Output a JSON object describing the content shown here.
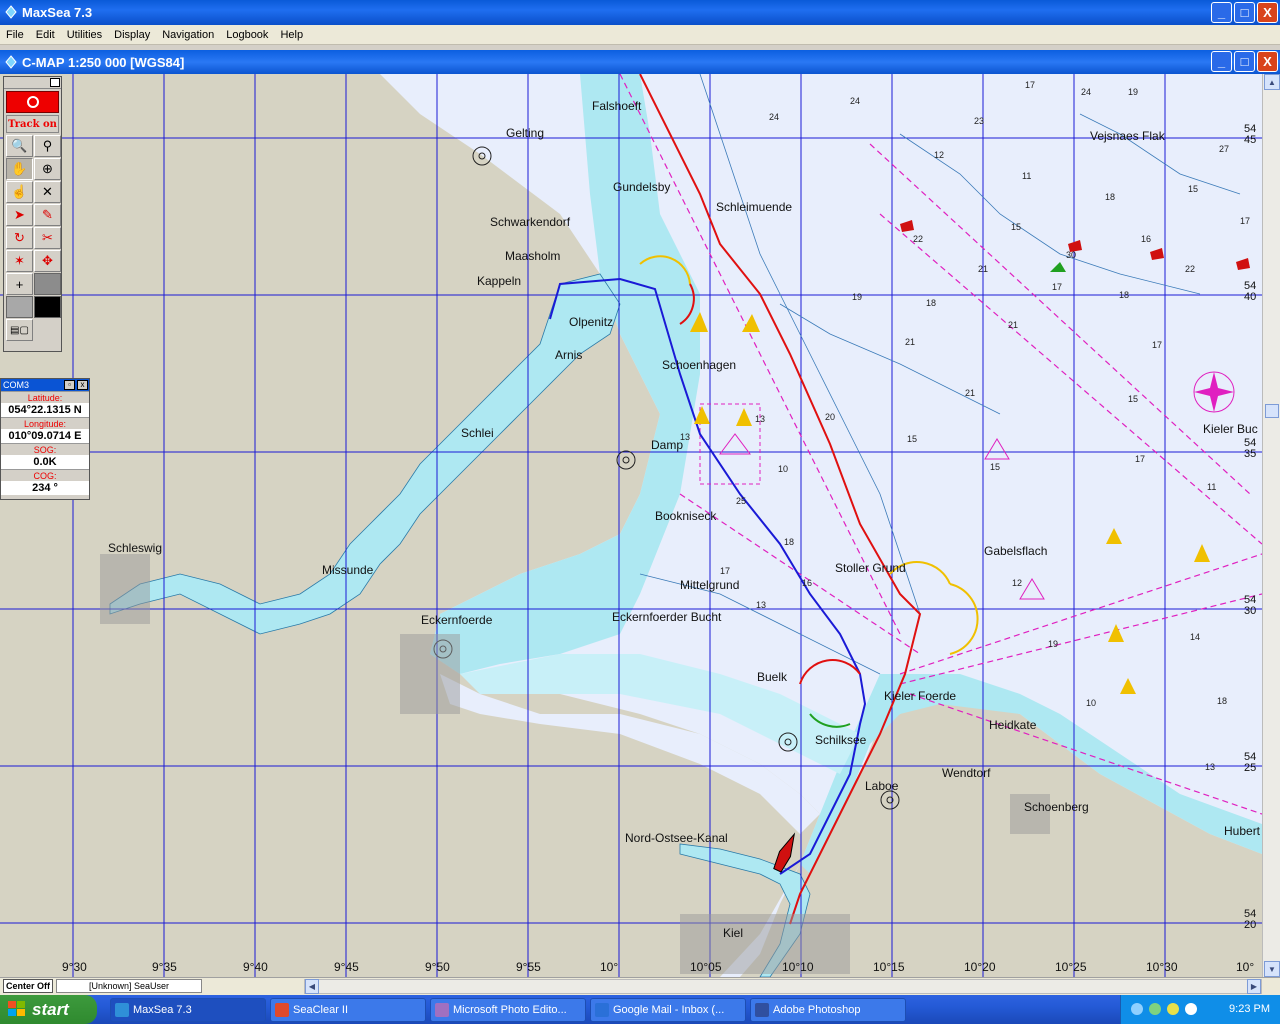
{
  "window": {
    "title": "MaxSea 7.3",
    "buttons": {
      "min": "_",
      "max": "□",
      "close": "X"
    }
  },
  "menu": [
    "File",
    "Edit",
    "Utilities",
    "Display",
    "Navigation",
    "Logbook",
    "Help"
  ],
  "chart_window": {
    "title": "C-MAP  1:250 000 [WGS84]"
  },
  "toolbox": {
    "track_label": "Track on"
  },
  "com_panel": {
    "title": "COM3",
    "latitude_label": "Latitude:",
    "latitude": "054°22.1315 N",
    "longitude_label": "Longitude:",
    "longitude": "010°09.0714 E",
    "sog_label": "SOG:",
    "sog": "0.0K",
    "cog_label": "COG:",
    "cog": "234 °"
  },
  "places": [
    {
      "name": "Falshoeft"
    },
    {
      "name": "Gelting"
    },
    {
      "name": "Gundelsby"
    },
    {
      "name": "Schwarkendorf"
    },
    {
      "name": "Maasholm"
    },
    {
      "name": "Kappeln"
    },
    {
      "name": "Olpenitz"
    },
    {
      "name": "Arnis"
    },
    {
      "name": "Schoenhagen"
    },
    {
      "name": "Schlei"
    },
    {
      "name": "Damp"
    },
    {
      "name": "Bookniseck"
    },
    {
      "name": "Schleswig"
    },
    {
      "name": "Missunde"
    },
    {
      "name": "Eckernfoerde"
    },
    {
      "name": "Mittelgrund"
    },
    {
      "name": "Eckernfoerder Bucht"
    },
    {
      "name": "Stoller Grund"
    },
    {
      "name": "Gabelsflach"
    },
    {
      "name": "Buelk"
    },
    {
      "name": "Kieler Foerde"
    },
    {
      "name": "Schilksee"
    },
    {
      "name": "Heidkate"
    },
    {
      "name": "Laboe"
    },
    {
      "name": "Wendtorf"
    },
    {
      "name": "Schoenberg"
    },
    {
      "name": "Nord-Ostsee-Kanal"
    },
    {
      "name": "Kiel"
    },
    {
      "name": "Vejsnaes Flak"
    },
    {
      "name": "Kieler Buc"
    },
    {
      "name": "Schleimuende"
    },
    {
      "name": "Hubert"
    }
  ],
  "depths": [
    "24",
    "23",
    "24",
    "19",
    "27",
    "17",
    "24",
    "12",
    "11",
    "15",
    "18",
    "17",
    "15",
    "16",
    "22",
    "30",
    "17",
    "18",
    "22",
    "21",
    "21",
    "19",
    "18",
    "17",
    "15",
    "13",
    "10",
    "21",
    "21",
    "15",
    "15",
    "11",
    "17",
    "13",
    "25",
    "18",
    "16",
    "14",
    "13",
    "19",
    "10",
    "13",
    "12",
    "11",
    "17",
    "18",
    "20"
  ],
  "lon_labels": [
    "9°30",
    "9°35",
    "9°40",
    "9°45",
    "9°50",
    "9°55",
    "10°",
    "10°05",
    "10°10",
    "10°15",
    "10°20",
    "10°25",
    "10°30",
    "10°"
  ],
  "lat_labels": [
    "54\n45",
    "54\n40",
    "54\n35",
    "54\n30",
    "54\n25",
    "54\n20"
  ],
  "statusbar": {
    "center": "Center Off",
    "user": "[Unknown] SeaUser"
  },
  "taskbar": {
    "start": "start",
    "items": [
      {
        "label": "MaxSea 7.3",
        "color": "#2f8fd8"
      },
      {
        "label": "SeaClear II",
        "color": "#e04a2a"
      },
      {
        "label": "Microsoft Photo Edito...",
        "color": "#a070c0"
      },
      {
        "label": "Google Mail - Inbox (...",
        "color": "#2a70d8"
      },
      {
        "label": "Adobe Photoshop",
        "color": "#3050a0"
      }
    ],
    "clock": "9:23 PM"
  },
  "colors": {
    "land": "#d6d3c3",
    "shallow": "#aee8f2",
    "sea": "#e8eefc",
    "grid": "#1a1ad6",
    "track_red": "#e01010",
    "track_blue": "#1a1ad6",
    "magenta": "#e020c0"
  }
}
